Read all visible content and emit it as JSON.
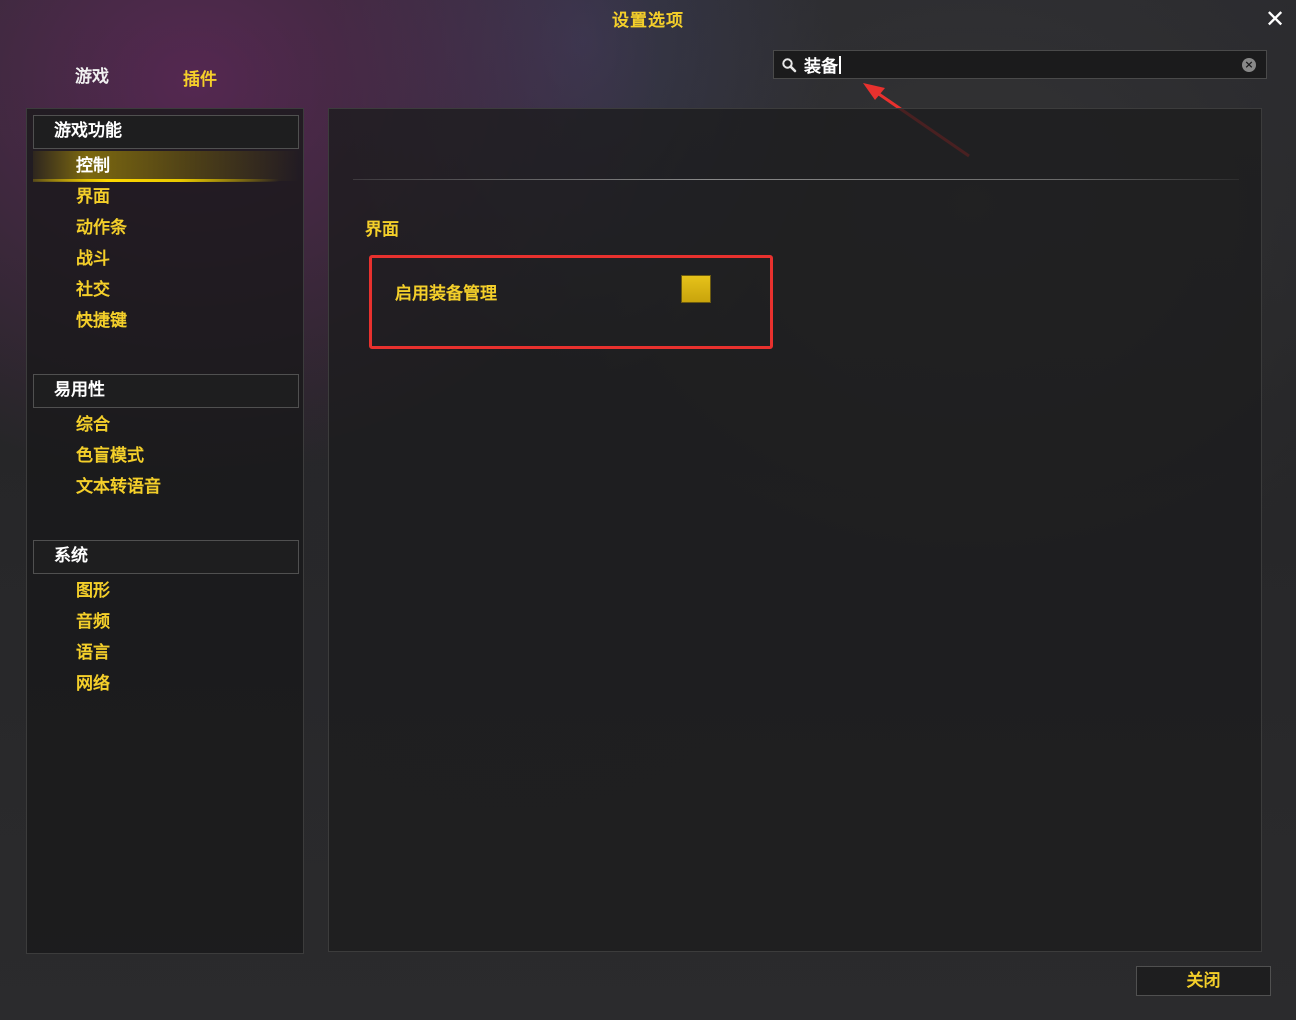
{
  "window": {
    "title": "设置选项",
    "close_icon": "✕"
  },
  "tabs": {
    "game": "游戏",
    "addons": "插件"
  },
  "search": {
    "value": "装备"
  },
  "sidebar": {
    "categories": [
      {
        "title": "游戏功能",
        "items": [
          "控制",
          "界面",
          "动作条",
          "战斗",
          "社交",
          "快捷键"
        ]
      },
      {
        "title": "易用性",
        "items": [
          "综合",
          "色盲模式",
          "文本转语音"
        ]
      },
      {
        "title": "系统",
        "items": [
          "图形",
          "音频",
          "语言",
          "网络"
        ]
      }
    ],
    "selected_item": "控制"
  },
  "main": {
    "section_title": "界面",
    "settings": [
      {
        "label": "启用装备管理",
        "checked": true
      }
    ]
  },
  "footer": {
    "close_label": "关闭"
  },
  "colors": {
    "accent": "#f4cf2a",
    "annotation_red": "#e8312e"
  }
}
